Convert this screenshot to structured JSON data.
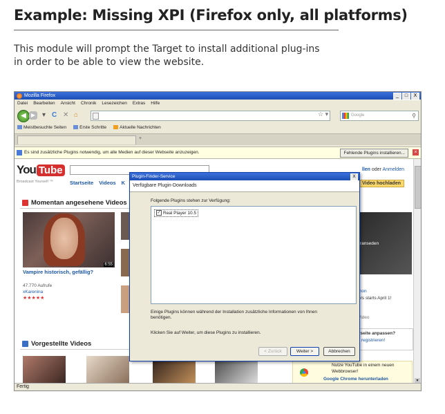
{
  "header": {
    "title": "Example: Missing XPI (Firefox only, all platforms)",
    "intro_lines": [
      "This module will prompt the Target to install additional plug-ins",
      "in order to be able to view the website."
    ]
  },
  "browser": {
    "window_title": "Mozilla Firefox",
    "window_buttons": [
      "_",
      "□",
      "X"
    ],
    "menu": [
      "Datei",
      "Bearbeiten",
      "Ansicht",
      "Chronik",
      "Lesezeichen",
      "Extras",
      "Hilfe"
    ],
    "search_placeholder": "Google",
    "bookmarks": [
      "Meistbesuchte Seiten",
      "Erste Schritte",
      "Aktuelle Nachrichten"
    ],
    "plugin_notice": "Es sind zusätzliche Plugins notwendig, um alle Medien auf dieser Webseite anzuzeigen.",
    "plugin_notice_button": "Fehlende Plugins installieren...",
    "status": "Fertig"
  },
  "youtube": {
    "logo_you": "You",
    "logo_tube": "Tube",
    "tagline": "Broadcast Yourself ™",
    "nav": [
      "Startseite",
      "Videos",
      "K"
    ],
    "top_right_links": [
      "llen",
      "oder",
      "Anmelden"
    ],
    "upload_button": "Video hochladen",
    "section1_title": "Momentan angesehene Videos",
    "video_duration": "6:55",
    "video_title": "Vampire historisch, gefällig?",
    "video_views": "47.770 Aufrufe",
    "video_author": "xKarenina",
    "video_stars": "★★★★★",
    "right_label": "ranseden",
    "right_link1": "mon",
    "right_text1": "ors starts April 1!",
    "right_text2": "Video",
    "right_box_line1": "rseite anpassen?",
    "right_box_line2": "r registrieren!",
    "section2_title": "Vorgestellte Videos",
    "chrome_line1": "Nutze YouTube in einem neuen",
    "chrome_line2": "Webbrowser!",
    "chrome_line3": "Google Chrome herunterladen"
  },
  "dialog": {
    "title": "Plugin-Finder-Service",
    "close": "X",
    "header": "Verfügbare Plugin-Downloads",
    "list_label": "Folgende Plugins stehen zur Verfügung:",
    "plugin_item": "Real Player 10.5",
    "plugin_checked": "✓",
    "info_text": "Einige Plugins können während der Installation zusätzliche Informationen von Ihnen benötigen.",
    "instruction": "Klicken Sie auf Weiter, um diese Plugins zu installieren.",
    "btn_back": "< Zurück",
    "btn_next": "Weiter >",
    "btn_cancel": "Abbrechen"
  }
}
